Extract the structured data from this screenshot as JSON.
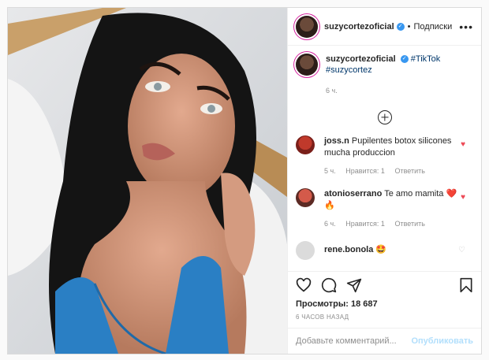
{
  "post": {
    "media_alt": "Selfie photo",
    "header": {
      "username": "suzycortezoficial",
      "separator": "•",
      "follow_label": "Подписки",
      "more_label": "•••"
    },
    "caption": {
      "username": "suzycortezoficial",
      "hashtag1": "#TikTok",
      "hashtag2": "#suzycortez",
      "time": "6 ч."
    },
    "comments": [
      {
        "username": "joss.n",
        "text": "Pupilentes botox silicones mucha produccion",
        "time": "5 ч.",
        "likes": "Нравится: 1",
        "reply": "Ответить",
        "liked": true
      },
      {
        "username": "atonioserrano",
        "text": "Te amo mamita ❤️ 🔥",
        "time": "6 ч.",
        "likes": "Нравится: 1",
        "reply": "Ответить",
        "liked": true
      },
      {
        "username": "rene.bonola",
        "text": "🤩",
        "liked": false
      }
    ],
    "views_label": "Просмотры: 18 687",
    "posted_ago": "6 ЧАСОВ НАЗАД",
    "add_comment_placeholder": "Добавьте комментарий...",
    "publish_label": "Опубликовать",
    "colors": {
      "like_red": "#ed4956",
      "link": "#00376b",
      "verified": "#3897f0",
      "swim_blue": "#2a7fc4"
    }
  }
}
